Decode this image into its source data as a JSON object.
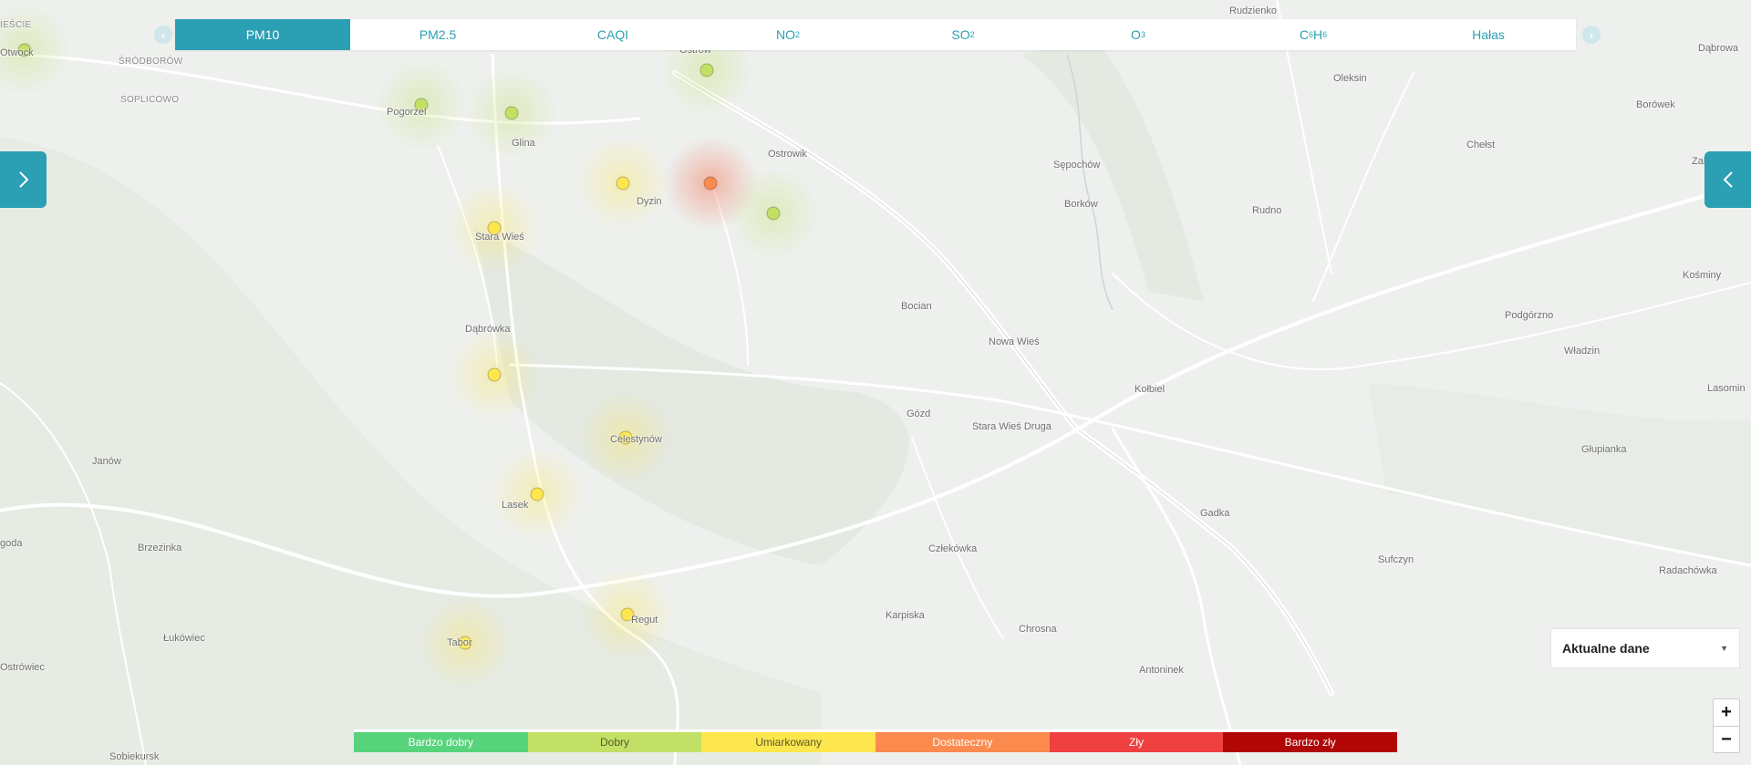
{
  "tabs": [
    {
      "main": "PM10",
      "sub": "",
      "rest": "",
      "active": true
    },
    {
      "main": "PM2.5",
      "sub": "",
      "rest": "",
      "active": false
    },
    {
      "main": "CAQI",
      "sub": "",
      "rest": "",
      "active": false
    },
    {
      "main": "NO",
      "sub": "2",
      "rest": "",
      "active": false
    },
    {
      "main": "SO",
      "sub": "2",
      "rest": "",
      "active": false
    },
    {
      "main": "O",
      "sub": "3",
      "rest": "",
      "active": false
    },
    {
      "main": "C",
      "sub": "6",
      "rest": "H",
      "sub2": "6",
      "active": false
    },
    {
      "main": "Hałas",
      "sub": "",
      "rest": "",
      "active": false
    }
  ],
  "data_select": {
    "selected": "Aktualne dane"
  },
  "zoom": {
    "in": "+",
    "out": "−"
  },
  "legend": [
    {
      "label": "Bardzo dobry",
      "color": "#57d47b",
      "text_color": "#ffffff"
    },
    {
      "label": "Dobry",
      "color": "#c2e065",
      "text_color": "#5a5a2a"
    },
    {
      "label": "Umiarkowany",
      "color": "#fde64e",
      "text_color": "#5a5a2a"
    },
    {
      "label": "Dostateczny",
      "color": "#fb8a4f",
      "text_color": "#ffffff"
    },
    {
      "label": "Zły",
      "color": "#ef4040",
      "text_color": "#ffffff"
    },
    {
      "label": "Bardzo zły",
      "color": "#b10606",
      "text_color": "#ffffff"
    }
  ],
  "map_labels": [
    "Otwock",
    "ŚRÓDBORÓW",
    "SOPLICOWO",
    "Pogorzel",
    "Glina",
    "Ostrów",
    "Ostrowik",
    "Dyzin",
    "Stara Wieś",
    "Dąbrówka",
    "Celestynów",
    "Lasek",
    "Regut",
    "Tabor",
    "Janów",
    "Brzezinka",
    "Łukówiec",
    "Ostrówiec",
    "Sobiekursk",
    "goda",
    "IEŚCIE",
    "Rudzienko",
    "Oleksin",
    "Dąbrowa",
    "Borówek",
    "Chełst",
    "Zalesie",
    "Sępochów",
    "Borków",
    "Rudno",
    "Bocian",
    "Nowa Wieś",
    "Kośminy",
    "Podgórzno",
    "Władzin",
    "Kołbiel",
    "Gózd",
    "Stara Wieś Druga",
    "Lasomin",
    "Głupianka",
    "Gadka",
    "Człekówka",
    "Sufczyn",
    "Radachówka",
    "Karpiska",
    "Chrosna",
    "Antoninek"
  ],
  "stations": [
    {
      "category": "Dobry"
    },
    {
      "category": "Dobry"
    },
    {
      "category": "Dobry"
    },
    {
      "category": "Dobry"
    },
    {
      "category": "Dostateczny"
    },
    {
      "category": "Dobry"
    },
    {
      "category": "Umiarkowany"
    },
    {
      "category": "Umiarkowany"
    },
    {
      "category": "Umiarkowany"
    },
    {
      "category": "Umiarkowany"
    },
    {
      "category": "Umiarkowany"
    },
    {
      "category": "Umiarkowany"
    },
    {
      "category": "Umiarkowany"
    }
  ]
}
